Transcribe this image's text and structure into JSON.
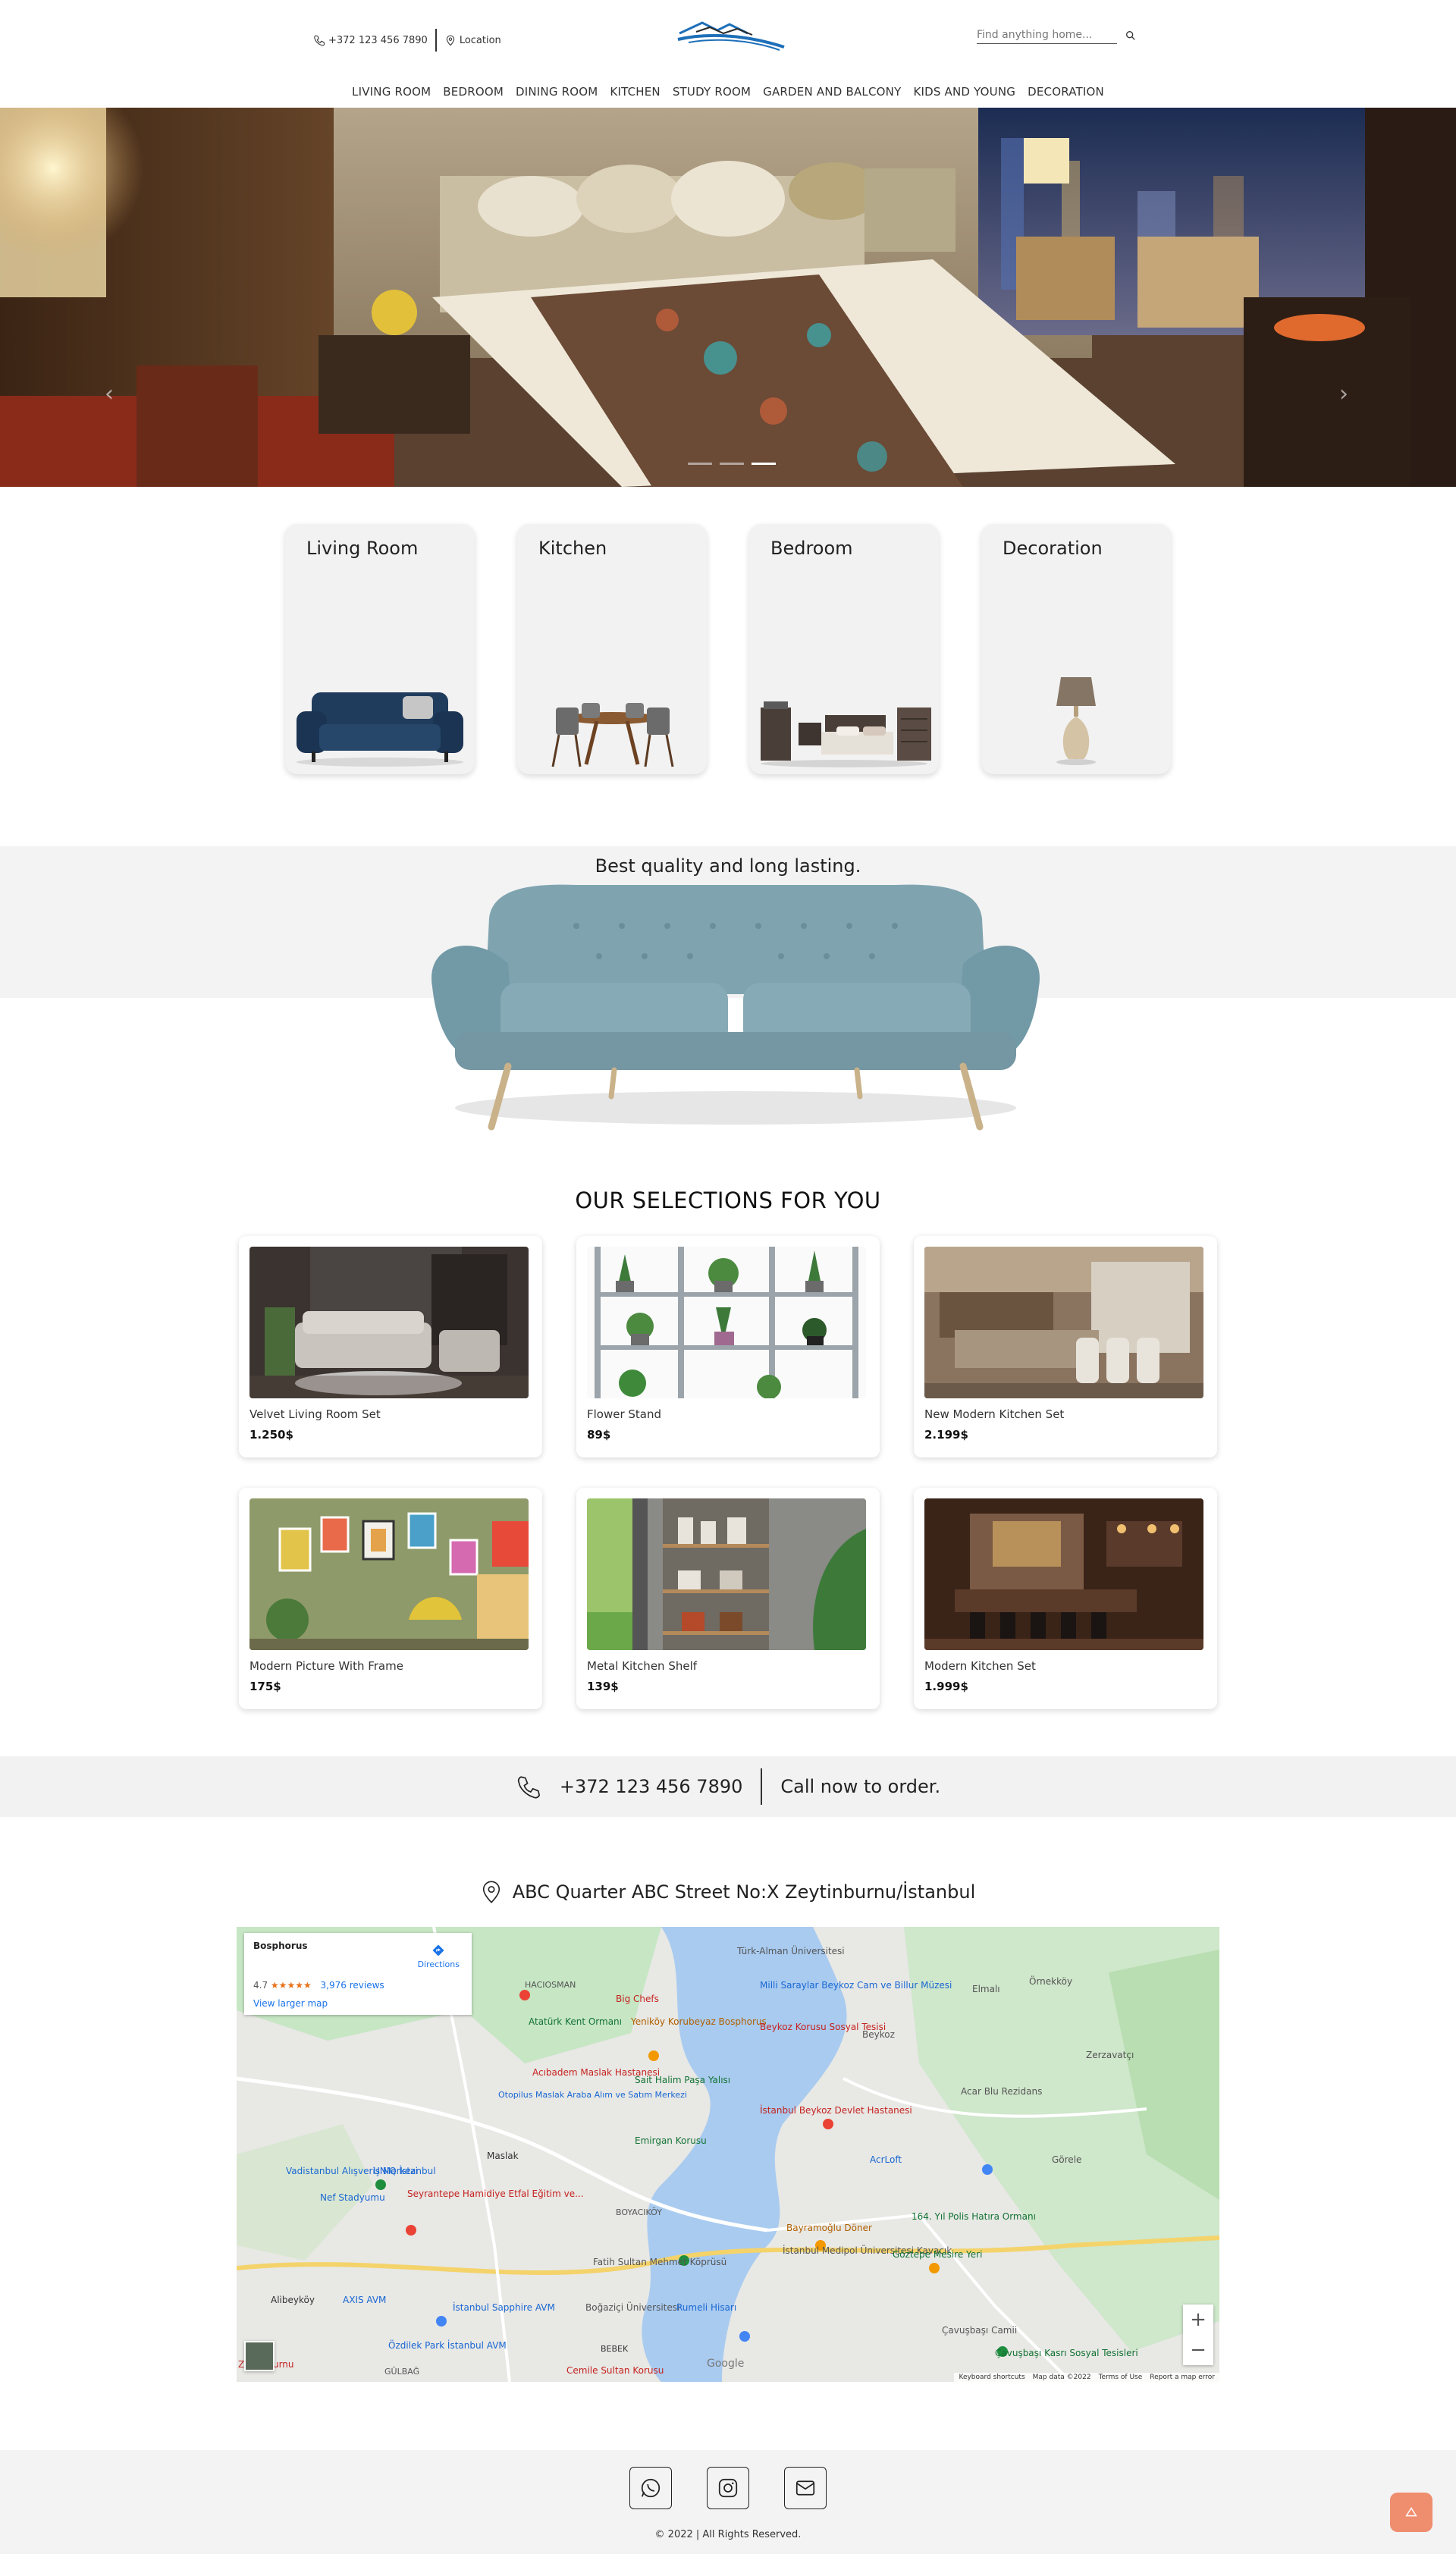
{
  "header": {
    "phone": "+372 123 456 7890",
    "location_label": "Location",
    "search_placeholder": "Find anything home..."
  },
  "nav": [
    "LIVING ROOM",
    "BEDROOM",
    "DINING ROOM",
    "KITCHEN",
    "STUDY ROOM",
    "GARDEN AND BALCONY",
    "KIDS AND YOUNG",
    "DECORATION"
  ],
  "hero": {
    "active_slide": 2,
    "slide_count": 3
  },
  "categories": [
    {
      "label": "Living Room",
      "icon": "sofa-image"
    },
    {
      "label": "Kitchen",
      "icon": "dining-table-image"
    },
    {
      "label": "Bedroom",
      "icon": "bedroom-set-image"
    },
    {
      "label": "Decoration",
      "icon": "lamp-image"
    }
  ],
  "promo": {
    "headline": "Best quality and long lasting."
  },
  "selections": {
    "title": "OUR SELECTIONS FOR YOU",
    "items": [
      {
        "name": "Velvet Living Room Set",
        "price": "1.250$"
      },
      {
        "name": "Flower Stand",
        "price": "89$"
      },
      {
        "name": "New Modern Kitchen Set",
        "price": "2.199$"
      },
      {
        "name": "Modern Picture With Frame",
        "price": "175$"
      },
      {
        "name": "Metal Kitchen Shelf",
        "price": "139$"
      },
      {
        "name": "Modern Kitchen Set",
        "price": "1.999$"
      }
    ]
  },
  "call": {
    "phone": "+372 123 456 7890",
    "cta": "Call now to order."
  },
  "address": "ABC Quarter ABC Street No:X Zeytinburnu/İstanbul",
  "map": {
    "place_title": "Bosphorus",
    "rating": "4.7",
    "reviews": "3,976 reviews",
    "directions": "Directions",
    "larger_map": "View larger map",
    "attribution": [
      "Keyboard shortcuts",
      "Map data ©2022",
      "Terms of Use",
      "Report a map error"
    ],
    "provider": "Google",
    "labels": [
      "Türk-Alman Üniversitesi",
      "Milli Saraylar Beykoz Cam ve Billur Müzesi",
      "Elmalı",
      "Örnekköy",
      "HACIOSMAN",
      "Big Chefs",
      "Atatürk Kent Ormanı",
      "Yeniköy Korubeyaz Bosphorus",
      "Beykoz Korusu Sosyal Tesisi",
      "Beykoz",
      "Zerzavatçı",
      "Acıbadem Maslak Hastanesi",
      "Sait Halim Paşa Yalısı",
      "Acar Blu Rezidans",
      "Otopilus Maslak Araba Alım ve Satım Merkezi",
      "İstanbul Beykoz Devlet Hastanesi",
      "Maslak",
      "Emirgan Korusu",
      "AcrLoft",
      "Görele",
      "Vadistanbul Alışveriş Merkezi",
      "UNIQ İstanbul",
      "Seyrantepe Hamidiye Etfal Eğitim ve...",
      "Nef Stadyumu",
      "BOYACIKÖY",
      "Bayramoğlu Döner",
      "164. Yıl Polis Hatıra Ormanı",
      "İstanbul Medipol Üniversitesi Kavacık",
      "Göztepe Mesire Yeri",
      "Fatih Sultan Mehmet Köprüsü",
      "Alibeyköy",
      "AXIS AVM",
      "İstanbul Sapphire AVM",
      "Boğaziçi Üniversitesi",
      "Rumeli Hisarı",
      "Çavuşbaşı Camii",
      "Çavuşbaşı Kasrı Sosyal Tesisleri",
      "Özdilek Park İstanbul AVM",
      "BEBEK",
      "Cemile Sultan Korusu",
      "GÜLBAĞ",
      "Zeytinburnu"
    ]
  },
  "footer": {
    "copyright": "© 2022 | All Rights Reserved."
  }
}
